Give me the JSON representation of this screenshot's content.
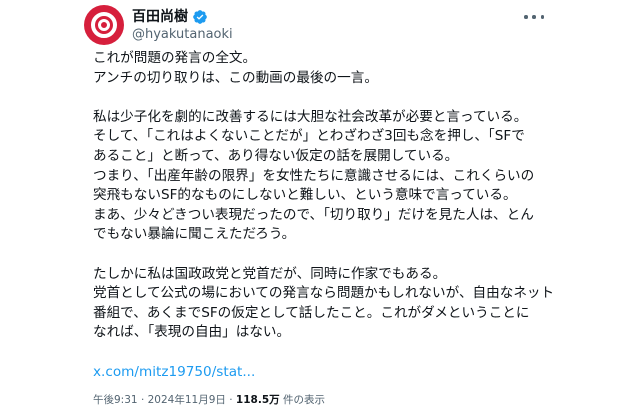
{
  "author": {
    "display_name": "百田尚樹",
    "handle": "@hyakutanaoki",
    "verified_icon": "verified-badge-icon",
    "avatar_color": "#d61f3c"
  },
  "tweet": {
    "lines": [
      "これが問題の発言の全文。",
      "アンチの切り取りは、この動画の最後の一言。",
      "",
      "私は少子化を劇的に改善するには大胆な社会改革が必要と言っている。",
      "そして、「これはよくないことだが」とわざわざ3回も念を押し、「SFで",
      "あること」と断って、あり得ない仮定の話を展開している。",
      "つまり、「出産年齢の限界」を女性たちに意識させるには、これくらいの",
      "突飛もないSF的なものにしないと難しい、という意味で言っている。",
      "まあ、少々どきつい表現だったので、「切り取り」だけを見た人は、とん",
      "でもない暴論に聞こえただろう。",
      "",
      "たしかに私は国政政党と党首だが、同時に作家でもある。",
      "党首として公式の場においての発言なら問題かもしれないが、自由なネット",
      "番組で、あくまでSFの仮定として話したこと。これがダメということに",
      "なれば、「表現の自由」はない。"
    ],
    "link_text": "x.com/mitz19750/stat...",
    "time": "午後9:31",
    "date": "2024年11月9日",
    "views_count": "118.5万",
    "views_label": "件の表示",
    "link_color": "#1d9bf0"
  }
}
